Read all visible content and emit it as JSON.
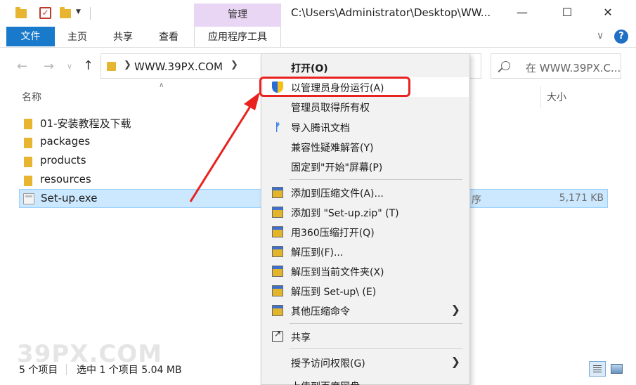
{
  "titlebar": {
    "manage_tab": "管理",
    "path": "C:\\Users\\Administrator\\Desktop\\WW...",
    "minimize": "—",
    "maximize": "☐",
    "close": "✕"
  },
  "ribbon": {
    "file": "文件",
    "home": "主页",
    "share": "共享",
    "view": "查看",
    "app_tools": "应用程序工具",
    "help": "?"
  },
  "address": {
    "path": "WWW.39PX.COM",
    "search_placeholder": "在 WWW.39PX.C..."
  },
  "columns": {
    "name": "名称",
    "size": "大小"
  },
  "files": [
    {
      "name": "01-安装教程及下载",
      "type": "",
      "size": "",
      "kind": "folder"
    },
    {
      "name": "packages",
      "type": "",
      "size": "",
      "kind": "folder"
    },
    {
      "name": "products",
      "type": "",
      "size": "",
      "kind": "folder"
    },
    {
      "name": "resources",
      "type": "",
      "size": "",
      "kind": "folder"
    },
    {
      "name": "Set-up.exe",
      "type": "序",
      "size": "5,171 KB",
      "kind": "exe",
      "selected": true
    }
  ],
  "status": {
    "count": "5 个项目",
    "selection": "选中 1 个项目  5.04 MB"
  },
  "watermark": "39PX.COM",
  "context_menu": {
    "items": [
      {
        "label": "打开(O)",
        "icon": "none",
        "bold": true
      },
      {
        "label": "以管理员身份运行(A)",
        "icon": "shield-icon"
      },
      {
        "label": "管理员取得所有权",
        "icon": "none"
      },
      {
        "label": "导入腾讯文档",
        "icon": "tencent-docs-icon"
      },
      {
        "label": "兼容性疑难解答(Y)",
        "icon": "none"
      },
      {
        "label": "固定到\"开始\"屏幕(P)",
        "icon": "none"
      },
      {
        "label": "添加到压缩文件(A)...",
        "icon": "winrar-icon"
      },
      {
        "label": "添加到 \"Set-up.zip\" (T)",
        "icon": "winrar-icon"
      },
      {
        "label": "用360压缩打开(Q)",
        "icon": "winrar-icon"
      },
      {
        "label": "解压到(F)...",
        "icon": "winrar-icon"
      },
      {
        "label": "解压到当前文件夹(X)",
        "icon": "winrar-icon"
      },
      {
        "label": "解压到 Set-up\\ (E)",
        "icon": "winrar-icon"
      },
      {
        "label": "其他压缩命令",
        "icon": "winrar-icon"
      },
      {
        "label": "共享",
        "icon": "share-icon"
      },
      {
        "label": "授予访问权限(G)",
        "icon": "none"
      },
      {
        "label": "上传到百度网盘",
        "icon": "none"
      }
    ]
  },
  "colors": {
    "accent": "#1979ca",
    "manage_tab_bg": "#e9d6f4",
    "selection_bg": "#cce8ff",
    "highlight_red": "#e8221e"
  }
}
